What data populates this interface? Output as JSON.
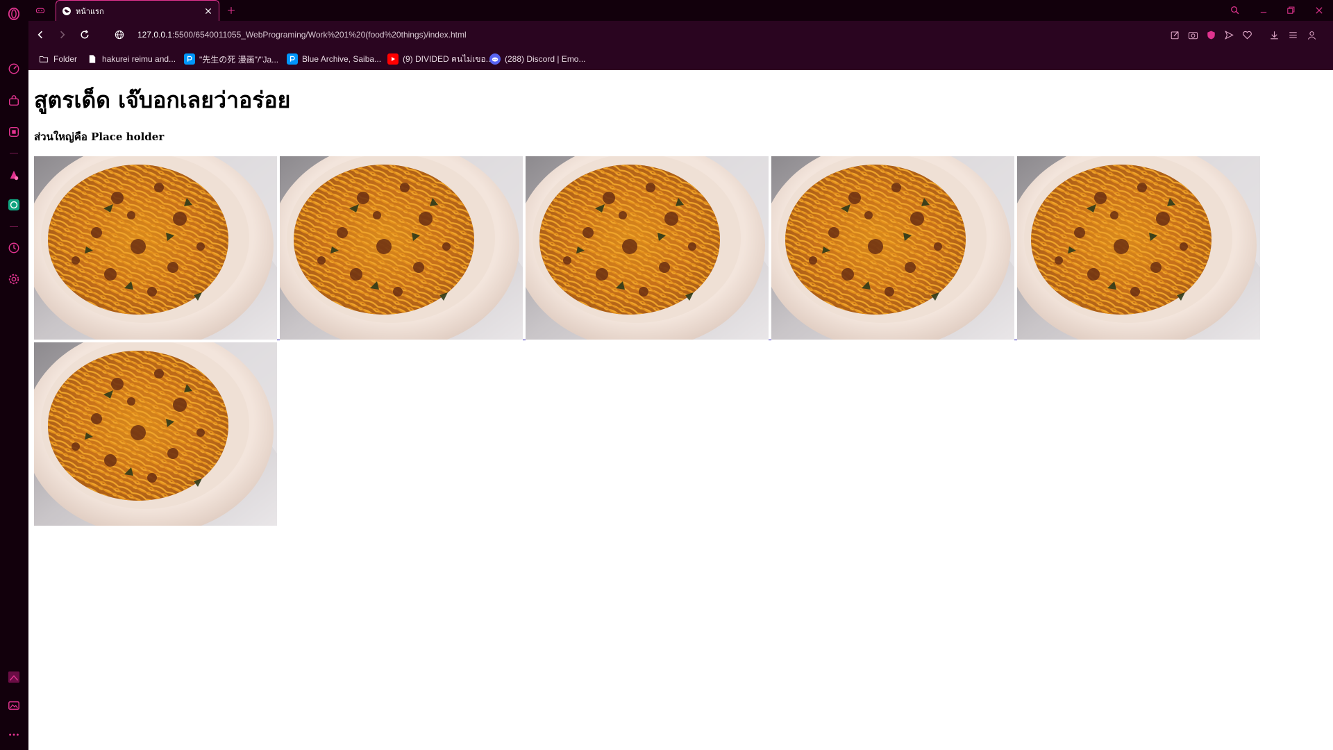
{
  "browser": {
    "tab": {
      "title": "หน้าแรก"
    },
    "address": {
      "host": "127.0.0.1",
      "path": ":5500/6540011055_WebPrograming/Work%201%20(food%20things)/index.html"
    },
    "bookmarks": [
      {
        "label": "Folder",
        "icon": "folder-icon"
      },
      {
        "label": "hakurei reimu and...",
        "icon": "page-icon"
      },
      {
        "label": "\"先生の死 漫画\"/\"Ja...",
        "icon": "pixiv-icon"
      },
      {
        "label": "Blue Archive, Saiba...",
        "icon": "pixiv-icon"
      },
      {
        "label": "(9) DIVIDED คนไม่เขอ...",
        "icon": "youtube-icon"
      },
      {
        "label": "(288) Discord | Emo...",
        "icon": "discord-icon"
      }
    ],
    "colors": {
      "accent": "#e0338f",
      "chrome_dark": "#12000c",
      "chrome_mid": "#2a0520"
    }
  },
  "page": {
    "heading": "สูตรเด็ด เจ๊บอกเลยว่าอร่อย",
    "subheading": "ส่วนใหญ่คือ Place holder",
    "images": [
      {
        "alt": "spaghetti bolognese"
      },
      {
        "alt": "spaghetti bolognese"
      },
      {
        "alt": "spaghetti bolognese"
      },
      {
        "alt": "spaghetti bolognese"
      },
      {
        "alt": "spaghetti bolognese"
      },
      {
        "alt": "spaghetti bolognese"
      }
    ]
  }
}
